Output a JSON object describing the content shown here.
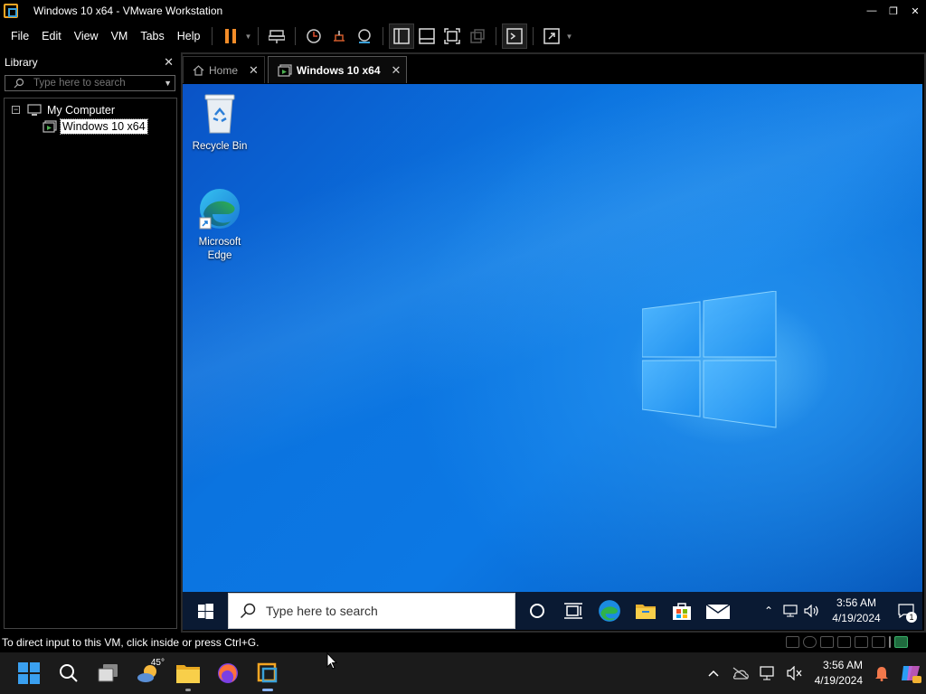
{
  "window": {
    "title": "Windows 10 x64 - VMware Workstation"
  },
  "menu": [
    "File",
    "Edit",
    "View",
    "VM",
    "Tabs",
    "Help"
  ],
  "library": {
    "title": "Library",
    "search_placeholder": "Type here to search",
    "tree": [
      {
        "label": "My Computer",
        "expanded": true
      },
      {
        "label": "Windows 10 x64",
        "selected": true
      }
    ]
  },
  "tabs": [
    {
      "label": "Home",
      "active": false,
      "icon": "home-icon"
    },
    {
      "label": "Windows 10 x64",
      "active": true,
      "icon": "vm-icon"
    }
  ],
  "guest": {
    "desktop_icons": [
      {
        "label": "Recycle Bin",
        "icon": "recycle-bin-icon"
      },
      {
        "label": "Microsoft Edge",
        "icon": "edge-icon"
      }
    ],
    "taskbar": {
      "search_placeholder": "Type here to search",
      "time": "3:56 AM",
      "date": "4/19/2024",
      "notification_count": "1"
    }
  },
  "status": {
    "message": "To direct input to this VM, click inside or press Ctrl+G."
  },
  "host_taskbar": {
    "weather_temp": "45°",
    "time": "3:56 AM",
    "date": "4/19/2024"
  },
  "colors": {
    "accent": "#0b74e0",
    "vmware_orange": "#f5a623",
    "pause_orange": "#f28c28"
  }
}
